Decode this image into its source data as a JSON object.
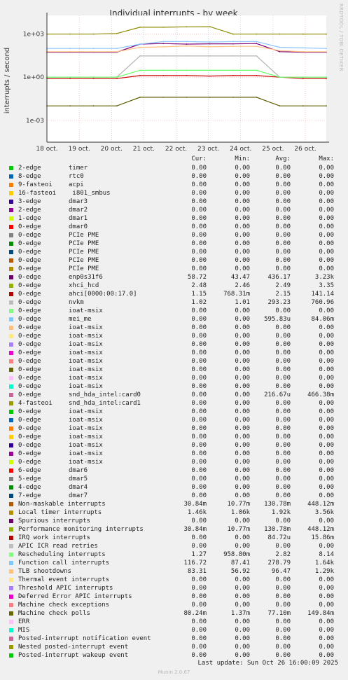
{
  "chart_data": {
    "type": "line",
    "title": "Individual interrupts - by week",
    "ylabel": "interrupts / second",
    "yscale": "log",
    "ylim": [
      3e-05,
      20000
    ],
    "yticks": [
      {
        "value": 1000,
        "label": "1e+03"
      },
      {
        "value": 1,
        "label": "1e+00"
      },
      {
        "value": 0.001,
        "label": "1e-03"
      }
    ],
    "xtick_labels": [
      "18 oct.",
      "19 oct.",
      "20 oct.",
      "21 oct.",
      "22 oct.",
      "23 oct.",
      "24 oct.",
      "25 oct.",
      "26 oct."
    ],
    "grid": true,
    "series": [
      {
        "name": "Local timer interrupts",
        "color": "#8c8c00",
        "values": [
          1000,
          1000,
          1000,
          1100,
          3000,
          3000,
          3200,
          3300,
          1000,
          1000,
          1000,
          1000,
          1000
        ]
      },
      {
        "name": "enp0s31f6",
        "color": "#7a0077",
        "values": [
          55,
          55,
          55,
          55,
          200,
          220,
          200,
          210,
          210,
          220,
          60,
          55,
          55
        ]
      },
      {
        "name": "ahci[0000:00:17.0]",
        "color": "#c80000",
        "values": [
          0.8,
          0.8,
          0.8,
          0.8,
          1.3,
          1.3,
          1.3,
          1.2,
          1.3,
          1.3,
          1.0,
          0.8,
          0.8
        ]
      },
      {
        "name": "nvkm",
        "color": "#b4b4b4",
        "values": [
          1.0,
          1.0,
          1.0,
          1.0,
          30,
          30,
          30,
          30,
          30,
          30,
          1.0,
          1.0,
          1.0
        ]
      },
      {
        "name": "Function call interrupts",
        "color": "#8cc4ff",
        "values": [
          100,
          100,
          100,
          100,
          200,
          300,
          300,
          280,
          300,
          300,
          120,
          110,
          100
        ]
      },
      {
        "name": "TLB shootdowns",
        "color": "#ffc080",
        "values": [
          60,
          60,
          60,
          60,
          120,
          130,
          150,
          130,
          140,
          140,
          70,
          60,
          60
        ]
      },
      {
        "name": "Machine check polls",
        "color": "#5c5c00",
        "values": [
          0.01,
          0.01,
          0.01,
          0.01,
          0.04,
          0.04,
          0.04,
          0.04,
          0.04,
          0.04,
          0.01,
          0.01,
          0.01
        ]
      },
      {
        "name": "Rescheduling interrupts",
        "color": "#66ff66",
        "values": [
          1.0,
          1.0,
          1.0,
          1.0,
          3,
          3,
          3,
          3,
          3,
          3,
          1.0,
          1.0,
          1.0
        ]
      }
    ]
  },
  "side_text": "RRDTOOL / TOBI OETIKER",
  "legend": {
    "headers": [
      "Cur:",
      "Min:",
      "Avg:",
      "Max:"
    ],
    "rows": [
      {
        "color": "#00cc00",
        "name": "2-edge",
        "device": "timer",
        "cur": "0.00",
        "min": "0.00",
        "avg": "0.00",
        "max": "0.00"
      },
      {
        "color": "#0066b3",
        "name": "8-edge",
        "device": "rtc0",
        "cur": "0.00",
        "min": "0.00",
        "avg": "0.00",
        "max": "0.00"
      },
      {
        "color": "#ff8000",
        "name": "9-fasteoi",
        "device": "acpi",
        "cur": "0.00",
        "min": "0.00",
        "avg": "0.00",
        "max": "0.00"
      },
      {
        "color": "#ffcc00",
        "name": "16-fasteoi",
        "device": " i801_smbus",
        "cur": "0.00",
        "min": "0.00",
        "avg": "0.00",
        "max": "0.00"
      },
      {
        "color": "#330099",
        "name": "3-edge",
        "device": "dmar3",
        "cur": "0.00",
        "min": "0.00",
        "avg": "0.00",
        "max": "0.00"
      },
      {
        "color": "#990099",
        "name": "2-edge",
        "device": "dmar2",
        "cur": "0.00",
        "min": "0.00",
        "avg": "0.00",
        "max": "0.00"
      },
      {
        "color": "#ccff00",
        "name": "1-edge",
        "device": "dmar1",
        "cur": "0.00",
        "min": "0.00",
        "avg": "0.00",
        "max": "0.00"
      },
      {
        "color": "#ff0000",
        "name": "0-edge",
        "device": "dmar0",
        "cur": "0.00",
        "min": "0.00",
        "avg": "0.00",
        "max": "0.00"
      },
      {
        "color": "#808080",
        "name": "0-edge",
        "device": "PCIe PME",
        "cur": "0.00",
        "min": "0.00",
        "avg": "0.00",
        "max": "0.00"
      },
      {
        "color": "#008f00",
        "name": "0-edge",
        "device": "PCIe PME",
        "cur": "0.00",
        "min": "0.00",
        "avg": "0.00",
        "max": "0.00"
      },
      {
        "color": "#00487d",
        "name": "0-edge",
        "device": "PCIe PME",
        "cur": "0.00",
        "min": "0.00",
        "avg": "0.00",
        "max": "0.00"
      },
      {
        "color": "#b35a00",
        "name": "0-edge",
        "device": "PCIe PME",
        "cur": "0.00",
        "min": "0.00",
        "avg": "0.00",
        "max": "0.00"
      },
      {
        "color": "#b38f00",
        "name": "0-edge",
        "device": "PCIe PME",
        "cur": "0.00",
        "min": "0.00",
        "avg": "0.00",
        "max": "0.00"
      },
      {
        "color": "#6b006b",
        "name": "0-edge",
        "device": "enp0s31f6",
        "cur": "58.72",
        "min": "43.47",
        "avg": "436.17",
        "max": "3.23k"
      },
      {
        "color": "#8fb300",
        "name": "0-edge",
        "device": "xhci_hcd",
        "cur": "2.48",
        "min": "2.46",
        "avg": "2.49",
        "max": "3.35"
      },
      {
        "color": "#b30000",
        "name": "0-edge",
        "device": "ahci[0000:00:17.0]",
        "cur": "1.15",
        "min": "768.31m",
        "avg": "2.15",
        "max": "141.14"
      },
      {
        "color": "#bebebe",
        "name": "0-edge",
        "device": "nvkm",
        "cur": "1.02",
        "min": "1.01",
        "avg": "293.23",
        "max": "760.96"
      },
      {
        "color": "#80ff80",
        "name": "0-edge",
        "device": "ioat-msix",
        "cur": "0.00",
        "min": "0.00",
        "avg": "0.00",
        "max": "0.00"
      },
      {
        "color": "#80c9ff",
        "name": "0-edge",
        "device": "mei_me",
        "cur": "0.00",
        "min": "0.00",
        "avg": "595.83u",
        "max": "84.06m"
      },
      {
        "color": "#ffc080",
        "name": "0-edge",
        "device": "ioat-msix",
        "cur": "0.00",
        "min": "0.00",
        "avg": "0.00",
        "max": "0.00"
      },
      {
        "color": "#ffe680",
        "name": "0-edge",
        "device": "ioat-msix",
        "cur": "0.00",
        "min": "0.00",
        "avg": "0.00",
        "max": "0.00"
      },
      {
        "color": "#aa80ff",
        "name": "0-edge",
        "device": "ioat-msix",
        "cur": "0.00",
        "min": "0.00",
        "avg": "0.00",
        "max": "0.00"
      },
      {
        "color": "#ee00cc",
        "name": "0-edge",
        "device": "ioat-msix",
        "cur": "0.00",
        "min": "0.00",
        "avg": "0.00",
        "max": "0.00"
      },
      {
        "color": "#ff8080",
        "name": "0-edge",
        "device": "ioat-msix",
        "cur": "0.00",
        "min": "0.00",
        "avg": "0.00",
        "max": "0.00"
      },
      {
        "color": "#666600",
        "name": "0-edge",
        "device": "ioat-msix",
        "cur": "0.00",
        "min": "0.00",
        "avg": "0.00",
        "max": "0.00"
      },
      {
        "color": "#ffbfff",
        "name": "0-edge",
        "device": "ioat-msix",
        "cur": "0.00",
        "min": "0.00",
        "avg": "0.00",
        "max": "0.00"
      },
      {
        "color": "#00ffcc",
        "name": "0-edge",
        "device": "ioat-msix",
        "cur": "0.00",
        "min": "0.00",
        "avg": "0.00",
        "max": "0.00"
      },
      {
        "color": "#cc6699",
        "name": "0-edge",
        "device": "snd_hda_intel:card0",
        "cur": "0.00",
        "min": "0.00",
        "avg": "216.67u",
        "max": "466.38m"
      },
      {
        "color": "#999900",
        "name": "4-fasteoi",
        "device": "snd_hda_intel:card1",
        "cur": "0.00",
        "min": "0.00",
        "avg": "0.00",
        "max": "0.00"
      },
      {
        "color": "#00cc00",
        "name": "0-edge",
        "device": "ioat-msix",
        "cur": "0.00",
        "min": "0.00",
        "avg": "0.00",
        "max": "0.00"
      },
      {
        "color": "#0066b3",
        "name": "0-edge",
        "device": "ioat-msix",
        "cur": "0.00",
        "min": "0.00",
        "avg": "0.00",
        "max": "0.00"
      },
      {
        "color": "#ff8000",
        "name": "0-edge",
        "device": "ioat-msix",
        "cur": "0.00",
        "min": "0.00",
        "avg": "0.00",
        "max": "0.00"
      },
      {
        "color": "#ffcc00",
        "name": "0-edge",
        "device": "ioat-msix",
        "cur": "0.00",
        "min": "0.00",
        "avg": "0.00",
        "max": "0.00"
      },
      {
        "color": "#330099",
        "name": "0-edge",
        "device": "ioat-msix",
        "cur": "0.00",
        "min": "0.00",
        "avg": "0.00",
        "max": "0.00"
      },
      {
        "color": "#990099",
        "name": "0-edge",
        "device": "ioat-msix",
        "cur": "0.00",
        "min": "0.00",
        "avg": "0.00",
        "max": "0.00"
      },
      {
        "color": "#ccff00",
        "name": "0-edge",
        "device": "ioat-msix",
        "cur": "0.00",
        "min": "0.00",
        "avg": "0.00",
        "max": "0.00"
      },
      {
        "color": "#ff0000",
        "name": "6-edge",
        "device": "dmar6",
        "cur": "0.00",
        "min": "0.00",
        "avg": "0.00",
        "max": "0.00"
      },
      {
        "color": "#808080",
        "name": "5-edge",
        "device": "dmar5",
        "cur": "0.00",
        "min": "0.00",
        "avg": "0.00",
        "max": "0.00"
      },
      {
        "color": "#008f00",
        "name": "4-edge",
        "device": "dmar4",
        "cur": "0.00",
        "min": "0.00",
        "avg": "0.00",
        "max": "0.00"
      },
      {
        "color": "#00487d",
        "name": "7-edge",
        "device": "dmar7",
        "cur": "0.00",
        "min": "0.00",
        "avg": "0.00",
        "max": "0.00"
      },
      {
        "color": "#b35a00",
        "name": "Non-maskable interrupts",
        "device": "",
        "cur": "30.84m",
        "min": "10.77m",
        "avg": "130.78m",
        "max": "448.12m"
      },
      {
        "color": "#b38f00",
        "name": "Local timer interrupts",
        "device": "",
        "cur": "1.46k",
        "min": "1.06k",
        "avg": "1.92k",
        "max": "3.56k"
      },
      {
        "color": "#6b006b",
        "name": "Spurious interrupts",
        "device": "",
        "cur": "0.00",
        "min": "0.00",
        "avg": "0.00",
        "max": "0.00"
      },
      {
        "color": "#8fb300",
        "name": "Performance monitoring interrupts",
        "device": "",
        "cur": "30.84m",
        "min": "10.77m",
        "avg": "130.78m",
        "max": "448.12m"
      },
      {
        "color": "#b30000",
        "name": "IRQ work interrupts",
        "device": "",
        "cur": "0.00",
        "min": "0.00",
        "avg": "84.72u",
        "max": "15.86m"
      },
      {
        "color": "#bebebe",
        "name": "APIC ICR read retries",
        "device": "",
        "cur": "0.00",
        "min": "0.00",
        "avg": "0.00",
        "max": "0.00"
      },
      {
        "color": "#80ff80",
        "name": "Rescheduling interrupts",
        "device": "",
        "cur": "1.27",
        "min": "958.80m",
        "avg": "2.82",
        "max": "8.14"
      },
      {
        "color": "#80c9ff",
        "name": "Function call interrupts",
        "device": "",
        "cur": "116.72",
        "min": "87.41",
        "avg": "278.79",
        "max": "1.64k"
      },
      {
        "color": "#ffc080",
        "name": "TLB shootdowns",
        "device": "",
        "cur": "83.31",
        "min": "56.92",
        "avg": "96.47",
        "max": "1.29k"
      },
      {
        "color": "#ffe680",
        "name": "Thermal event interrupts",
        "device": "",
        "cur": "0.00",
        "min": "0.00",
        "avg": "0.00",
        "max": "0.00"
      },
      {
        "color": "#aa80ff",
        "name": "Threshold APIC interrupts",
        "device": "",
        "cur": "0.00",
        "min": "0.00",
        "avg": "0.00",
        "max": "0.00"
      },
      {
        "color": "#ee00cc",
        "name": "Deferred Error APIC interrupts",
        "device": "",
        "cur": "0.00",
        "min": "0.00",
        "avg": "0.00",
        "max": "0.00"
      },
      {
        "color": "#ff8080",
        "name": "Machine check exceptions",
        "device": "",
        "cur": "0.00",
        "min": "0.00",
        "avg": "0.00",
        "max": "0.00"
      },
      {
        "color": "#666600",
        "name": "Machine check polls",
        "device": "",
        "cur": "80.24m",
        "min": "1.37m",
        "avg": "77.10m",
        "max": "149.84m"
      },
      {
        "color": "#ffbfff",
        "name": "ERR",
        "device": "",
        "cur": "0.00",
        "min": "0.00",
        "avg": "0.00",
        "max": "0.00"
      },
      {
        "color": "#00ffcc",
        "name": "MIS",
        "device": "",
        "cur": "0.00",
        "min": "0.00",
        "avg": "0.00",
        "max": "0.00"
      },
      {
        "color": "#cc6699",
        "name": "Posted-interrupt notification event",
        "device": "",
        "cur": "0.00",
        "min": "0.00",
        "avg": "0.00",
        "max": "0.00"
      },
      {
        "color": "#999900",
        "name": "Nested posted-interrupt event",
        "device": "",
        "cur": "0.00",
        "min": "0.00",
        "avg": "0.00",
        "max": "0.00"
      },
      {
        "color": "#00cc00",
        "name": "Posted-interrupt wakeup event",
        "device": "",
        "cur": "0.00",
        "min": "0.00",
        "avg": "0.00",
        "max": "0.00"
      }
    ]
  },
  "footer": {
    "last_update": "Last update: Sun Oct 26 16:00:09 2025",
    "version": "Munin 2.0.67"
  }
}
